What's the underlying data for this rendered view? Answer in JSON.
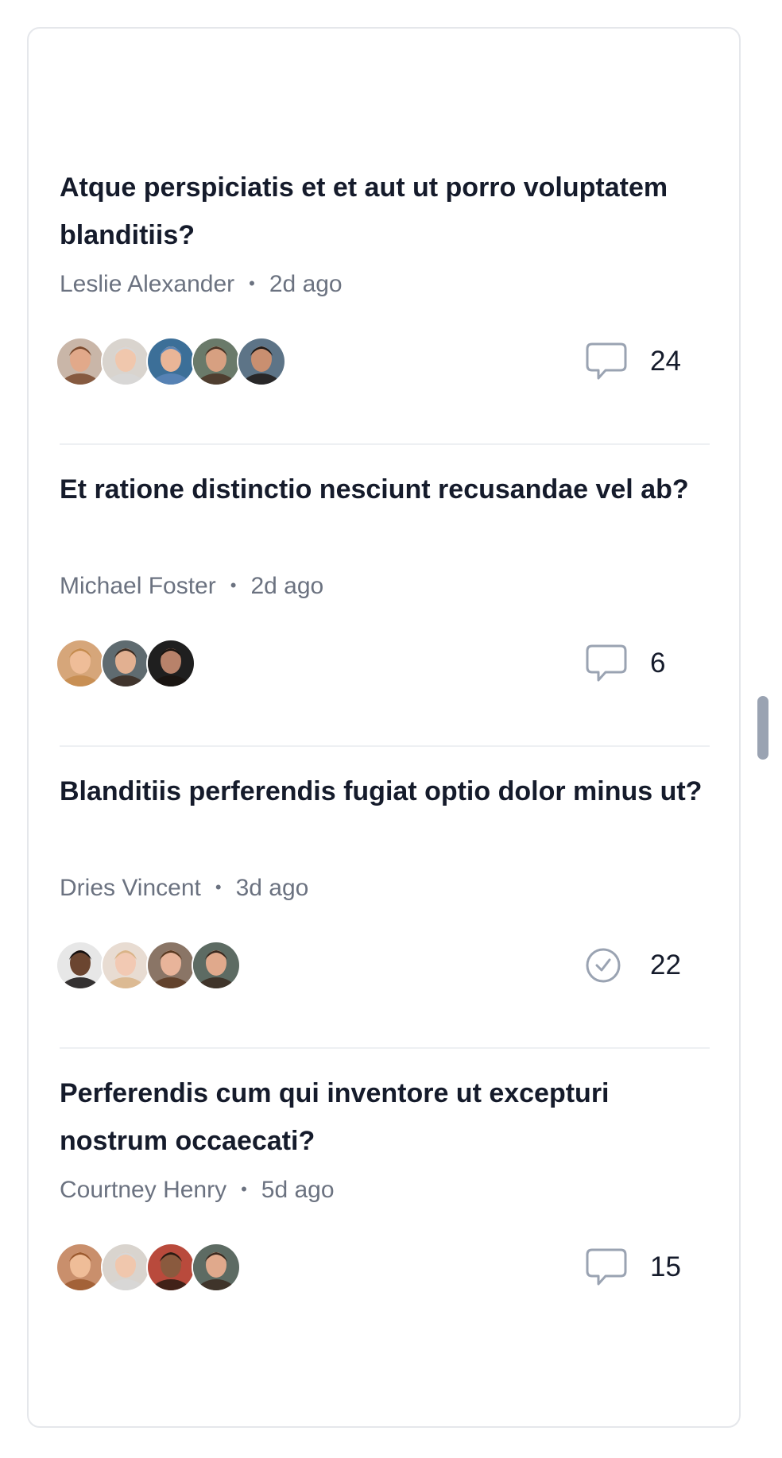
{
  "threads": [
    {
      "title": "Atque perspiciatis et et aut ut porro voluptatem blanditiis?",
      "author": "Leslie Alexander",
      "time": "2d ago",
      "status_icon": "chat-bubble-icon",
      "count": "24",
      "avatars": [
        {
          "skin": "#e2a98a",
          "hair": "#7a4a2e",
          "bg": "#c9b6a8"
        },
        {
          "skin": "#f0c7ad",
          "hair": "#d7d7d7",
          "bg": "#d9d4ce"
        },
        {
          "skin": "#e9b597",
          "hair": "#5a86b8",
          "bg": "#3c6f98"
        },
        {
          "skin": "#d7a081",
          "hair": "#4a3426",
          "bg": "#6a7a6a"
        },
        {
          "skin": "#c98f70",
          "hair": "#1f1a17",
          "bg": "#5d7487"
        }
      ]
    },
    {
      "title": "Et ratione distinctio nesciunt recusandae vel ab?",
      "author": "Michael Foster",
      "time": "2d ago",
      "status_icon": "chat-bubble-icon",
      "count": "6",
      "avatars": [
        {
          "skin": "#efbd98",
          "hair": "#c58b4e",
          "bg": "#d6a67a"
        },
        {
          "skin": "#e2b091",
          "hair": "#3b2a20",
          "bg": "#5f6b70"
        },
        {
          "skin": "#b8826a",
          "hair": "#1a1410",
          "bg": "#1f1f1f"
        }
      ]
    },
    {
      "title": "Blanditiis perferendis fugiat optio dolor minus ut?",
      "author": "Dries Vincent",
      "time": "3d ago",
      "status_icon": "check-circle-icon",
      "count": "22",
      "avatars": [
        {
          "skin": "#6b4530",
          "hair": "#141010",
          "bg": "#e7e7e7"
        },
        {
          "skin": "#f2c9b3",
          "hair": "#d9b488",
          "bg": "#e8dcd2"
        },
        {
          "skin": "#e8b49a",
          "hair": "#5a3a22",
          "bg": "#8a7566"
        },
        {
          "skin": "#e0a98c",
          "hair": "#3a2a20",
          "bg": "#5d6b63"
        }
      ]
    },
    {
      "title": "Perferendis cum qui inventore ut excepturi nostrum occaecati?",
      "author": "Courtney Henry",
      "time": "5d ago",
      "status_icon": "chat-bubble-icon",
      "count": "15",
      "avatars": [
        {
          "skin": "#efbd98",
          "hair": "#9c5a2f",
          "bg": "#c98f6c"
        },
        {
          "skin": "#f0c7ad",
          "hair": "#d7d7d7",
          "bg": "#d9d4ce"
        },
        {
          "skin": "#8a5a3e",
          "hair": "#2b1a12",
          "bg": "#b94a3c"
        },
        {
          "skin": "#e0a98c",
          "hair": "#3a2a20",
          "bg": "#5d6b63"
        }
      ]
    }
  ]
}
